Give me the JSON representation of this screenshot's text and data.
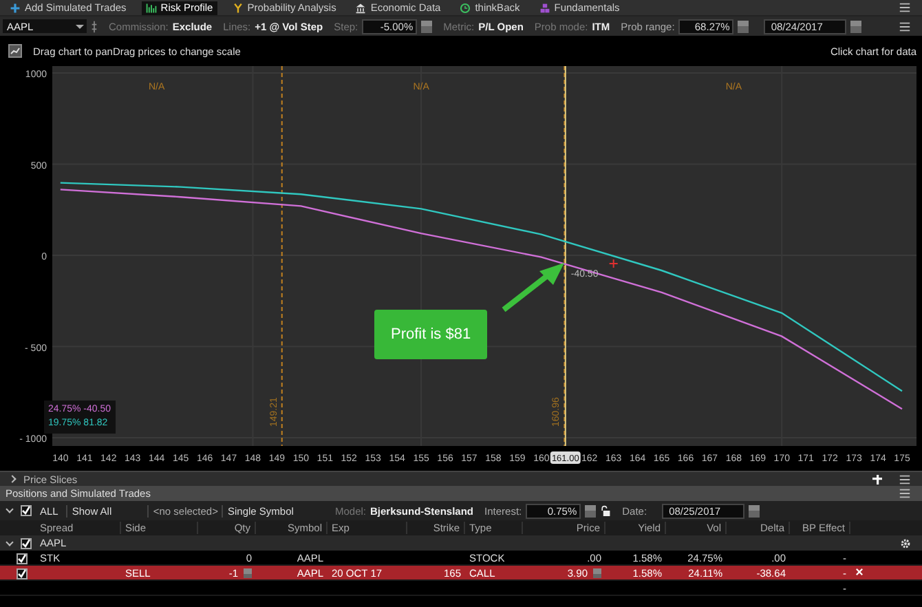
{
  "top_tabs": [
    {
      "label": "Add Simulated Trades",
      "selected": false
    },
    {
      "label": "Risk Profile",
      "selected": true
    },
    {
      "label": "Probability Analysis",
      "selected": false
    },
    {
      "label": "Economic Data",
      "selected": false
    },
    {
      "label": "thinkBack",
      "selected": false
    },
    {
      "label": "Fundamentals",
      "selected": false
    }
  ],
  "settings": {
    "symbol": "AAPL",
    "commission_label": "Commission:",
    "commission": "Exclude",
    "lines_label": "Lines:",
    "lines": "+1 @ Vol Step",
    "step_label": "Step:",
    "step": "-5.00%",
    "metric_label": "Metric:",
    "metric": "P/L Open",
    "prob_mode_label": "Prob mode:",
    "prob_mode": "ITM",
    "prob_range_label": "Prob range:",
    "prob_range": "68.27%",
    "date": "08/24/2017"
  },
  "hint_left": "Drag chart to panDrag prices to change scale",
  "hint_right": "Click chart for data",
  "chart": {
    "zone_labels": [
      "N/A",
      "N/A",
      "N/A"
    ],
    "readout": [
      {
        "value": "-40.50"
      },
      {
        "value": "81.82"
      }
    ],
    "callout": "Profit is $81",
    "chart_data": {
      "type": "line",
      "x": [
        140,
        145,
        150,
        155,
        160,
        165,
        170,
        175
      ],
      "series": [
        {
          "name": "24.75%",
          "color": "#d070d8",
          "values": [
            361,
            320,
            270,
            120,
            -10,
            -203,
            -444,
            -842
          ]
        },
        {
          "name": "19.75%",
          "color": "#30c8c0",
          "values": [
            398,
            375,
            335,
            255,
            115,
            -83,
            -316,
            -744
          ]
        }
      ],
      "xlim": [
        139.66,
        175.6
      ],
      "ylim": [
        -1000,
        1000
      ],
      "grid": true,
      "xticks": [
        140,
        141,
        142,
        143,
        144,
        145,
        146,
        147,
        148,
        149,
        150,
        151,
        152,
        153,
        154,
        155,
        156,
        157,
        158,
        159,
        160,
        {
          "value": 161,
          "label": "161.00"
        },
        162,
        163,
        164,
        165,
        166,
        167,
        168,
        169,
        170,
        171,
        172,
        173,
        174,
        175
      ],
      "yticks": [
        1000,
        500,
        0,
        -500,
        -1000
      ],
      "ref_lines": [
        {
          "axis": "x",
          "value": 149.21,
          "label": "149.21"
        },
        {
          "axis": "x",
          "value": 160.96,
          "label": "160.96"
        },
        {
          "axis": "x",
          "value": 161
        }
      ],
      "annotations": [
        {
          "x": 161,
          "y": -40.5,
          "text": "-40.50"
        }
      ]
    }
  },
  "price_slices": {
    "label": "Price Slices",
    "expanded": false
  },
  "positions": {
    "title": "Positions and Simulated Trades",
    "all_label": "ALL",
    "all_checked": true,
    "show": "Show All",
    "selected_label": "<no selected>",
    "mode": "Single Symbol",
    "model_label": "Model:",
    "model": "Bjerksund-Stensland",
    "interest_label": "Interest:",
    "interest": "0.75%",
    "date_label": "Date:",
    "date": "08/25/2017",
    "columns": [
      "Spread",
      "Side",
      "Qty",
      "Symbol",
      "Exp",
      "Strike",
      "Type",
      "Price",
      "Yield",
      "Vol",
      "Delta",
      "BP Effect"
    ],
    "group": {
      "label": "AAPL",
      "checked": true,
      "expanded": true
    },
    "rows": [
      {
        "kind": "stock",
        "checked": true,
        "selected": false,
        "spread": "STK",
        "qty": "0",
        "symbol": "AAPL",
        "type": "STOCK",
        "price": ".00",
        "yield": "1.58%",
        "vol": "24.75%",
        "delta": ".00",
        "bp_effect": "-"
      },
      {
        "kind": "option",
        "checked": true,
        "selected": true,
        "side": "SELL",
        "qty": "-1",
        "symbol": "AAPL",
        "exp": "20 OCT 17",
        "strike": "165",
        "type": "CALL",
        "price": "3.90",
        "yield": "1.58%",
        "vol": "24.11%",
        "delta": "-38.64",
        "bp_effect": "-"
      },
      {
        "kind": "blank",
        "selected": false,
        "bp_effect": "-"
      }
    ]
  }
}
